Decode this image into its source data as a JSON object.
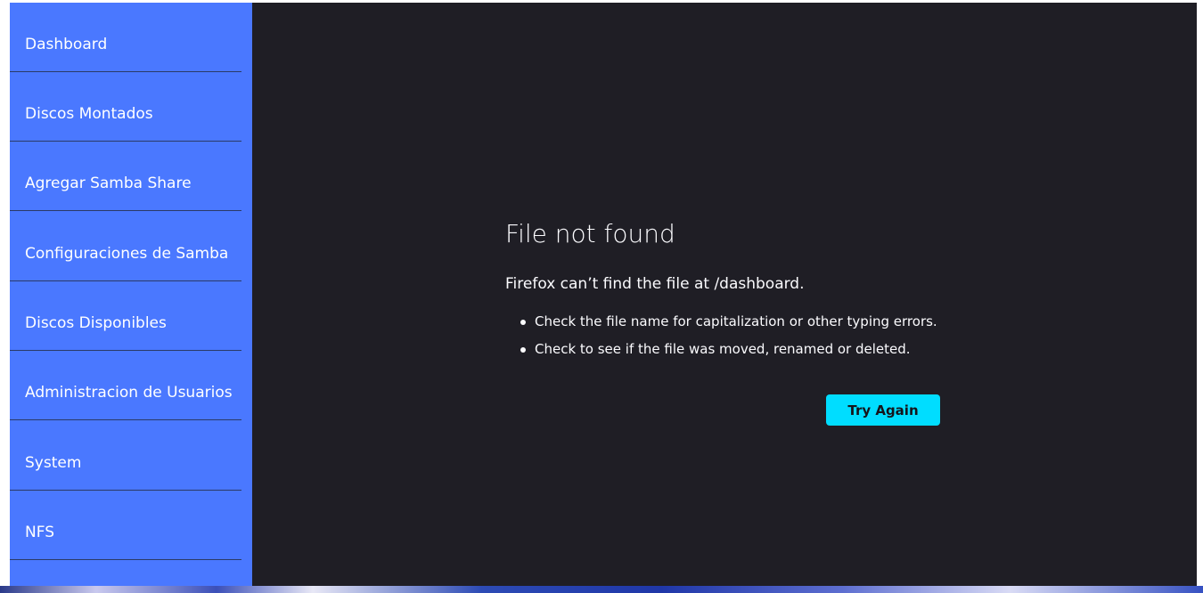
{
  "sidebar": {
    "items": [
      {
        "label": "Dashboard"
      },
      {
        "label": "Discos Montados"
      },
      {
        "label": "Agregar Samba Share"
      },
      {
        "label": "Configuraciones de Samba"
      },
      {
        "label": "Discos Disponibles"
      },
      {
        "label": "Administracion de Usuarios"
      },
      {
        "label": "System"
      },
      {
        "label": "NFS"
      }
    ]
  },
  "error": {
    "title": "File not found",
    "subtitle": "Firefox can’t find the file at /dashboard.",
    "tips": [
      "Check the file name for capitalization or other typing errors.",
      "Check to see if the file was moved, renamed or deleted."
    ],
    "button_label": "Try Again"
  },
  "colors": {
    "sidebar_bg": "#4a78ff",
    "main_bg": "#1f1e25",
    "button_bg": "#00ddff",
    "text": "#fbfbfe"
  }
}
